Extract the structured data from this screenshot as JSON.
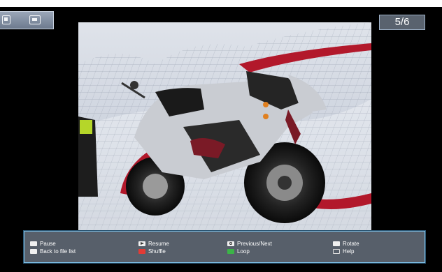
{
  "header": {
    "counter": "5/6"
  },
  "toolbar": {
    "icons": [
      "exit-icon",
      "fullscreen-icon"
    ]
  },
  "photo": {
    "subject": "motorcycle-image"
  },
  "help": {
    "row1": [
      {
        "label": "Pause",
        "key": "pause-key-icon"
      },
      {
        "label": "Resume",
        "key": "play-key-icon"
      },
      {
        "label": "Previous/Next",
        "key": "navigate-key-icon"
      },
      {
        "label": "Rotate",
        "key": "rotate-key-icon"
      }
    ],
    "row2": [
      {
        "label": "Back to file list",
        "key": "stop-key-icon"
      },
      {
        "label": "Shuffle",
        "key": "red-key-icon",
        "color": "#e23b35"
      },
      {
        "label": "Loop",
        "key": "green-key-icon",
        "color": "#3bb447"
      },
      {
        "label": "Help",
        "key": "help-key-icon"
      }
    ]
  }
}
